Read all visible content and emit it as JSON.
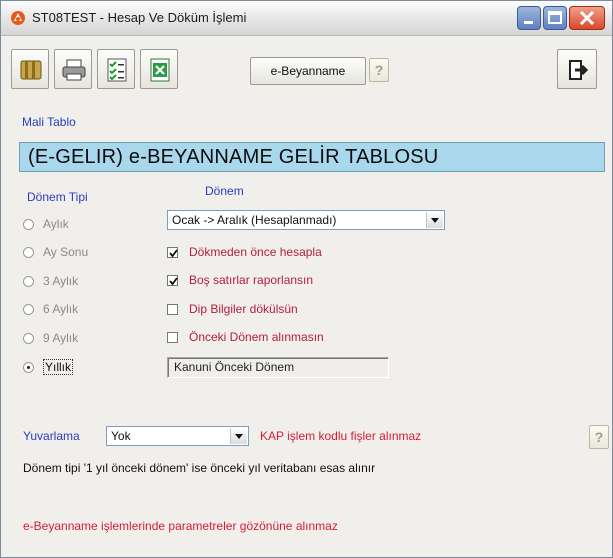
{
  "window": {
    "title": "ST08TEST - Hesap Ve Döküm İşlemi",
    "icon": "app-logo-icon"
  },
  "toolbar": {
    "buttons": [
      "book-icon",
      "printer-icon",
      "checklist-icon",
      "excel-icon"
    ],
    "ebeyanname_label": "e-Beyanname",
    "help_label": "?",
    "exit_icon": "exit-door-icon"
  },
  "section": {
    "mali_tablo_label": "Mali Tablo",
    "header_title": "(E-GELIR) e-BEYANNAME GELİR TABLOSU"
  },
  "donem_tipi": {
    "label": "Dönem Tipi",
    "options": [
      {
        "label": "Aylık",
        "selected": false
      },
      {
        "label": "Ay Sonu",
        "selected": false
      },
      {
        "label": "3 Aylık",
        "selected": false
      },
      {
        "label": "6 Aylık",
        "selected": false
      },
      {
        "label": "9 Aylık",
        "selected": false
      },
      {
        "label": "Yıllık",
        "selected": true
      }
    ]
  },
  "donem": {
    "label": "Dönem",
    "select_value": "Ocak -> Aralık (Hesaplanmadı)",
    "checkboxes": [
      {
        "label": "Dökmeden önce hesapla",
        "checked": true
      },
      {
        "label": "Boş satırlar raporlansın",
        "checked": true
      },
      {
        "label": "Dip Bilgiler dökülsün",
        "checked": false
      },
      {
        "label": "Önceki Dönem alınmasın",
        "checked": false
      }
    ],
    "readonly_value": "Kanuni Önceki Dönem"
  },
  "yuvarlama": {
    "label": "Yuvarlama",
    "select_value": "Yok"
  },
  "notes": {
    "kap_warning": "KAP işlem kodlu fişler alınmaz",
    "help_label": "?",
    "info": "Dönem tipi '1 yıl önceki dönem' ise önceki yıl veritabanı esas alınır",
    "footer_warning": "e-Beyanname işlemlerinde parametreler gözönüne alınmaz"
  },
  "colors": {
    "header_bg": "#a9d8ec",
    "label_blue": "#2b3dbd",
    "check_label": "#b51e3e",
    "warning_red": "#d81c34"
  }
}
